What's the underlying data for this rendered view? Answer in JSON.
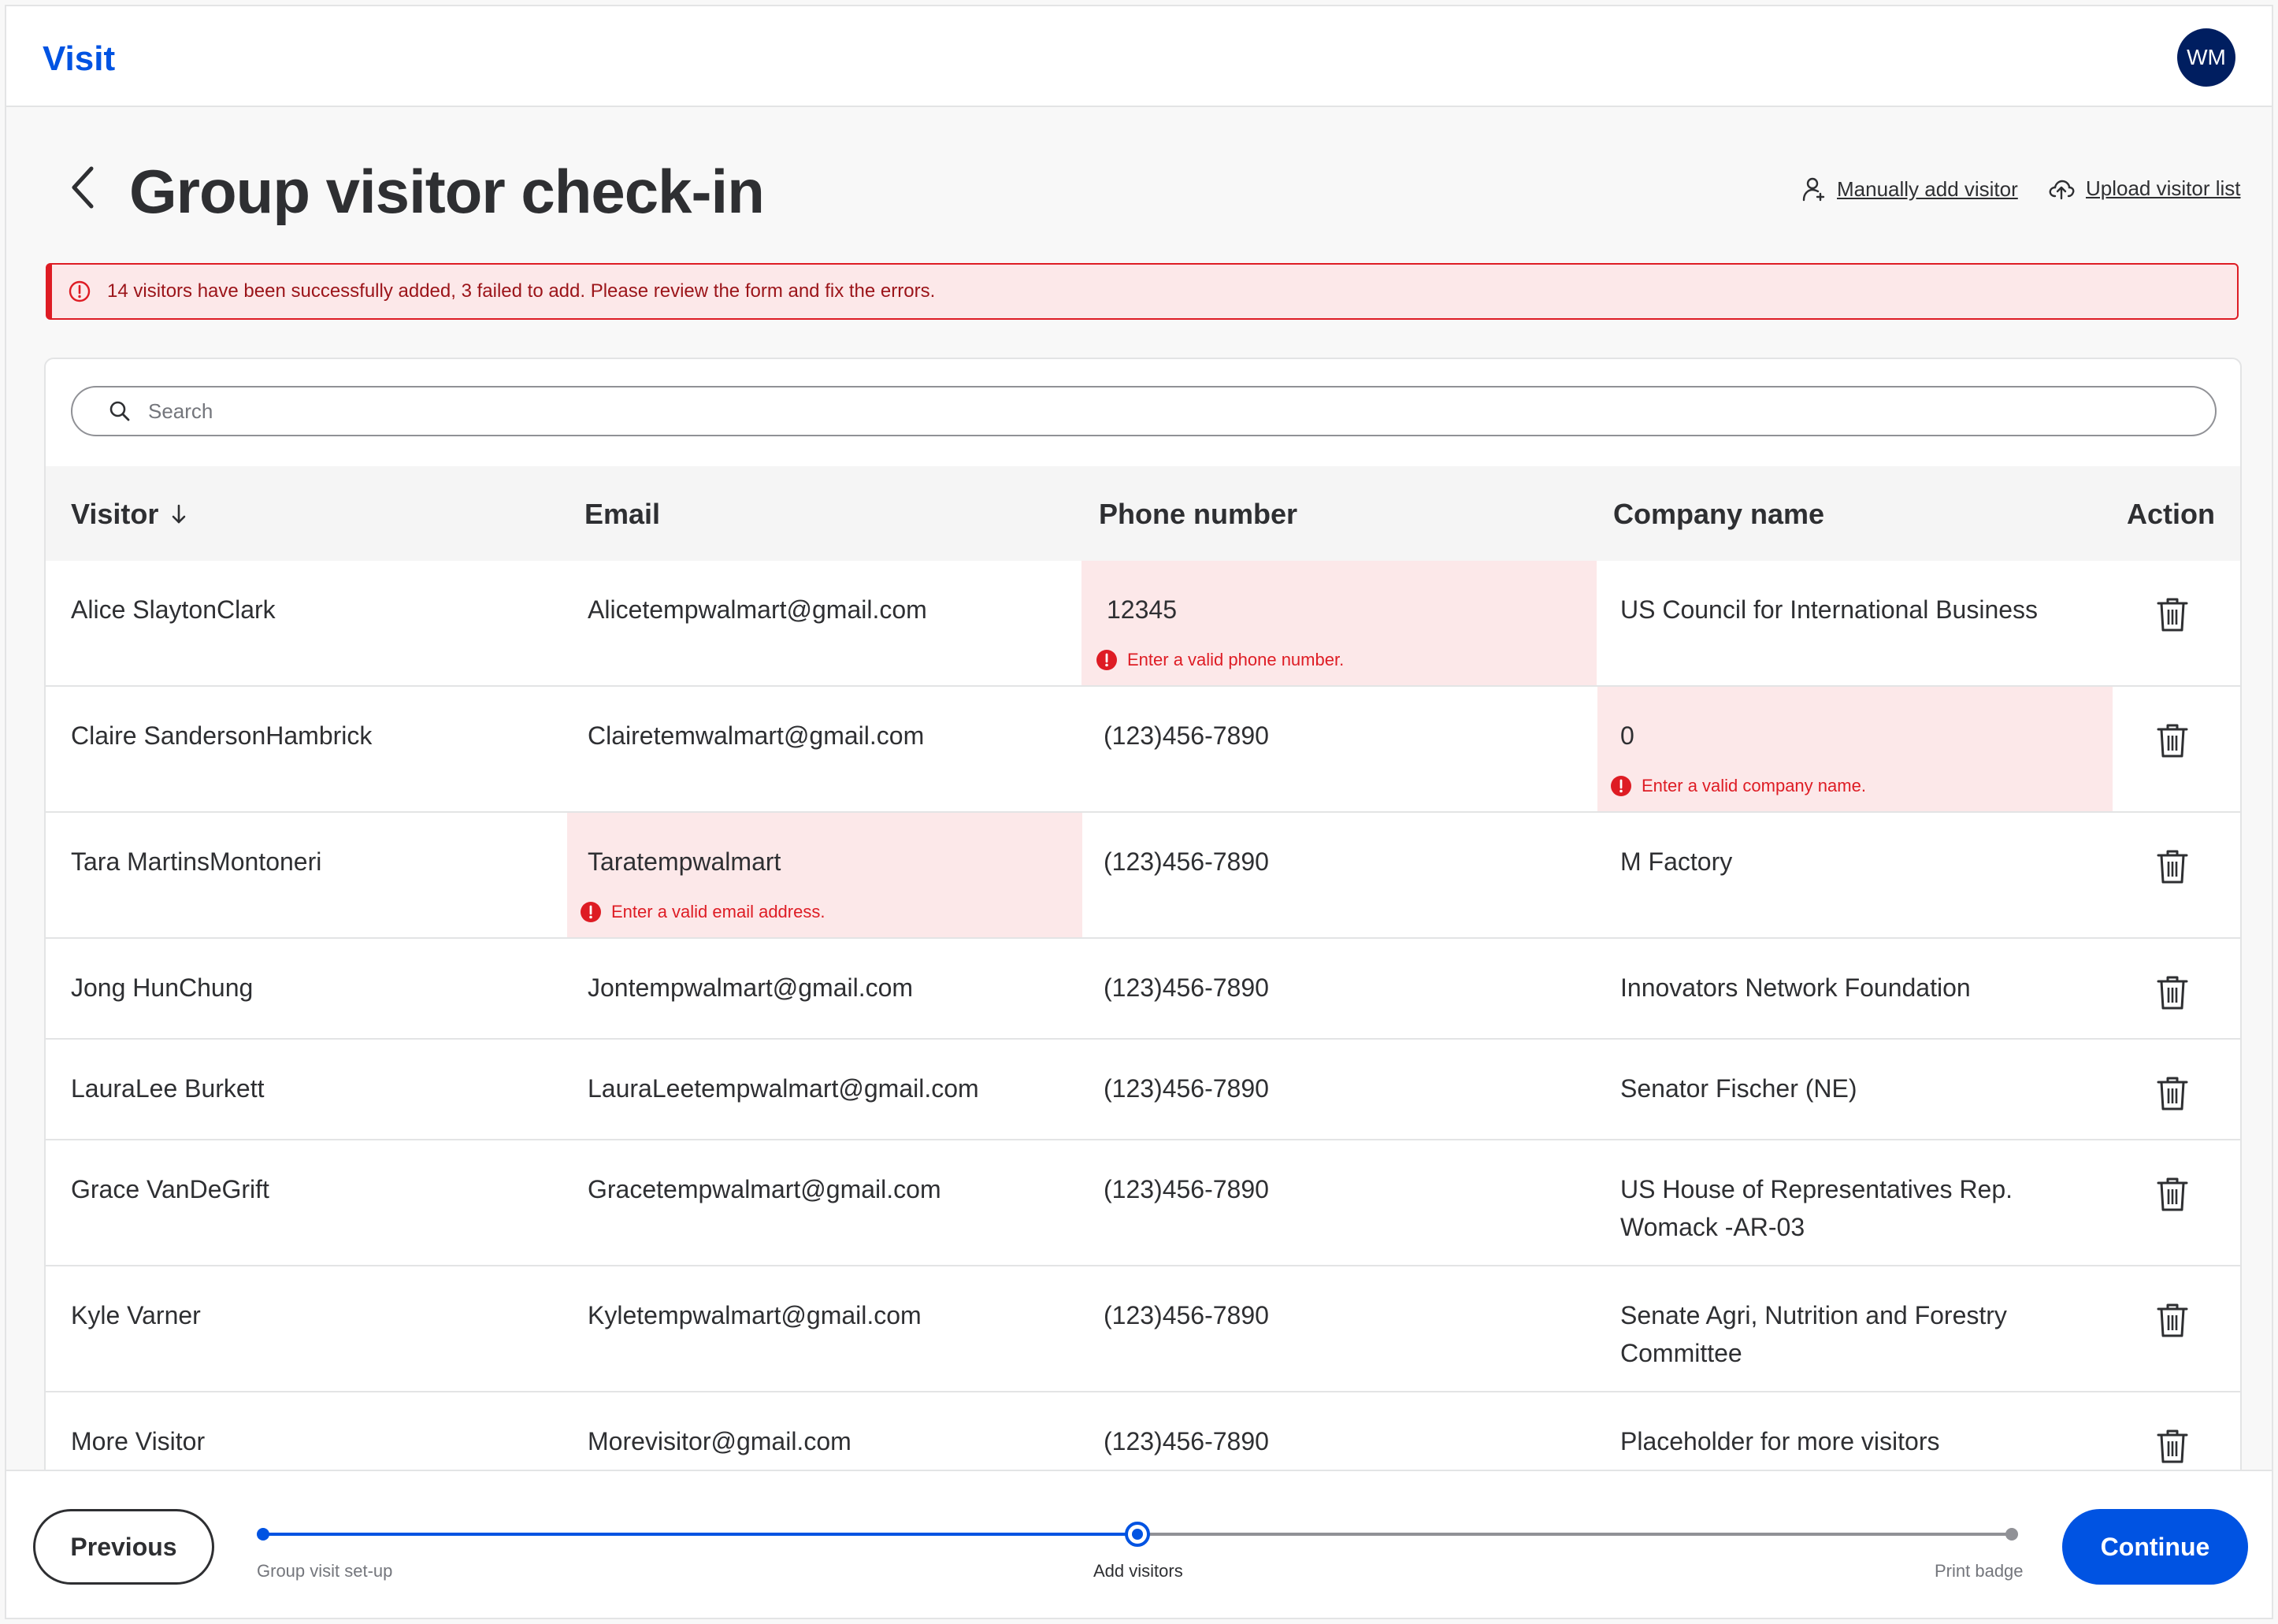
{
  "app": {
    "brand": "Visit",
    "avatar_initials": "WM"
  },
  "header": {
    "title": "Group visitor check-in",
    "manual_add_label": "Manually add visitor",
    "upload_label": "Upload visitor list"
  },
  "alert": {
    "message": "14 visitors have been successfully added, 3 failed to add. Please  review the form and fix the errors."
  },
  "search": {
    "placeholder": "Search",
    "value": ""
  },
  "table": {
    "columns": {
      "visitor": "Visitor",
      "email": "Email",
      "phone": "Phone number",
      "company": "Company name",
      "action": "Action"
    },
    "rows": [
      {
        "visitor": "Alice SlaytonClark",
        "email": "Alicetempwalmart@gmail.com",
        "phone": "12345",
        "company": "US Council for International Business",
        "phone_error": "Enter a valid phone number."
      },
      {
        "visitor": "Claire SandersonHambrick",
        "email": "Clairetemwalmart@gmail.com",
        "phone": "(123)456-7890",
        "company": "0",
        "company_error": "Enter a valid company name."
      },
      {
        "visitor": "Tara MartinsMontoneri",
        "email": "Taratempwalmart",
        "phone": "(123)456-7890",
        "company": "M Factory",
        "email_error": "Enter a valid email address."
      },
      {
        "visitor": "Jong HunChung",
        "email": "Jontempwalmart@gmail.com",
        "phone": "(123)456-7890",
        "company": "Innovators Network Foundation"
      },
      {
        "visitor": "LauraLee Burkett",
        "email": "LauraLeetempwalmart@gmail.com",
        "phone": "(123)456-7890",
        "company": "Senator Fischer (NE)"
      },
      {
        "visitor": "Grace VanDeGrift",
        "email": "Gracetempwalmart@gmail.com",
        "phone": "(123)456-7890",
        "company": "US House of Representatives Rep. Womack -AR-03"
      },
      {
        "visitor": "Kyle Varner",
        "email": "Kyletempwalmart@gmail.com",
        "phone": "(123)456-7890",
        "company": "Senate Agri, Nutrition and Forestry Committee"
      },
      {
        "visitor": "More Visitor",
        "email": "Morevisitor@gmail.com",
        "phone": "(123)456-7890",
        "company": "Placeholder for more visitors"
      }
    ]
  },
  "footer": {
    "previous_label": "Previous",
    "continue_label": "Continue",
    "steps": [
      "Group visit set-up",
      "Add visitors",
      "Print badge"
    ],
    "current_step": 2
  },
  "colors": {
    "brand_blue": "#0053e2",
    "error_red": "#de1c24",
    "error_bg": "#fce8e9",
    "avatar_navy": "#001e60"
  },
  "icons": [
    "back-chevron-icon",
    "person-add-icon",
    "cloud-upload-icon",
    "error-circle-icon",
    "search-icon",
    "sort-arrow-down-icon",
    "trash-icon"
  ]
}
